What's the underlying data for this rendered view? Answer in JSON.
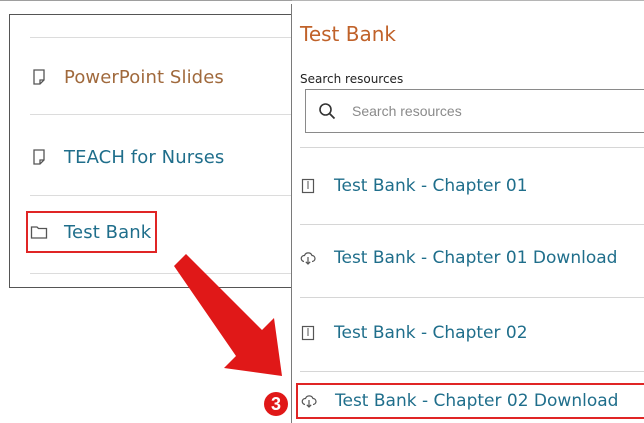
{
  "course_panel": {
    "items": [
      {
        "label": "PowerPoint Slides",
        "icon": "document-icon",
        "color": "#a0693c"
      },
      {
        "label": "TEACH for Nurses",
        "icon": "document-icon",
        "color": "#1f6e8b"
      },
      {
        "label": "Test Bank",
        "icon": "folder-icon",
        "color": "#1f6e8b",
        "highlighted": true
      }
    ]
  },
  "resources_panel": {
    "title": "Test Bank",
    "title_color": "#c0622a",
    "search": {
      "label": "Search resources",
      "placeholder": "Search resources"
    },
    "items": [
      {
        "label": "Test Bank - Chapter 01",
        "icon": "zip-file-icon"
      },
      {
        "label": "Test Bank - Chapter 01 Download",
        "icon": "cloud-download-icon"
      },
      {
        "label": "Test Bank - Chapter 02",
        "icon": "zip-file-icon"
      },
      {
        "label": "Test Bank - Chapter 02 Download",
        "icon": "cloud-download-icon",
        "highlighted": true
      }
    ]
  },
  "annotation": {
    "step": "3",
    "color": "#e01818"
  }
}
